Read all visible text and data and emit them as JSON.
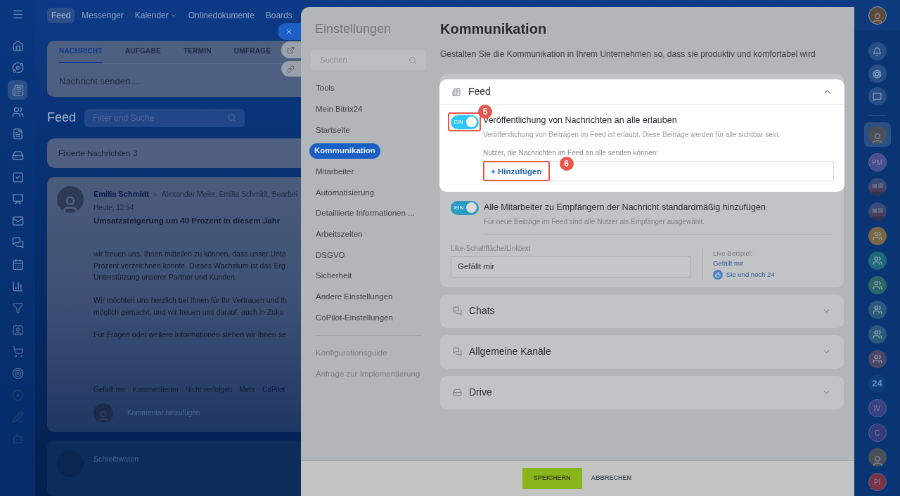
{
  "top_nav": [
    {
      "label": "Feed",
      "selected": true,
      "dropdown": false
    },
    {
      "label": "Messenger",
      "selected": false,
      "dropdown": false
    },
    {
      "label": "Kalender",
      "selected": false,
      "dropdown": true
    },
    {
      "label": "Onlinedokumente",
      "selected": false,
      "dropdown": false
    },
    {
      "label": "Boards",
      "selected": false,
      "dropdown": false
    }
  ],
  "composer": {
    "tabs": [
      {
        "label": "NACHRICHT",
        "selected": true
      },
      {
        "label": "AUFGABE",
        "selected": false
      },
      {
        "label": "TERMIN",
        "selected": false
      },
      {
        "label": "UMFRAGE",
        "selected": false
      }
    ],
    "placeholder": "Nachricht senden ..."
  },
  "feed": {
    "title": "Feed",
    "filter_placeholder": "Filter und Suche",
    "pinned": "Fixierte Nachrichten",
    "pinned_count": "3"
  },
  "post": {
    "author": "Emilia Schmidt",
    "recipients": "Alexander Meier, Emilia Schmidt, Bearbei",
    "time": "Heute, 12:54",
    "title": "Umsatzsteigerung um 40 Prozent in diesem Jahr",
    "paragraphs": [
      [
        "wir freuen uns, Ihnen mitteilen zu können, dass unser Unte",
        "Prozent verzeichnen konnte. Dieses Wachstum ist das Erg",
        "Unterstützung unserer Partner und Kunden."
      ],
      [
        "Wir möchten uns herzlich bei Ihnen für Ihr Vertrauen und Ih",
        "möglich gemacht, und wir freuen uns darauf, auch in Zuku"
      ],
      [
        "Für Fragen oder weitere Informationen stehen wir Ihnen se"
      ]
    ],
    "actions": [
      "Gefällt mir",
      "Kommentieren",
      "Nicht verfolgen",
      "Mehr",
      "CoPilot"
    ],
    "comment_placeholder": "Kommentar hinzufügen"
  },
  "next_post": {
    "author": "Schreibwaren"
  },
  "settings": {
    "title": "Einstellungen",
    "search_placeholder": "Suchen",
    "nav": [
      {
        "label": "Tools",
        "selected": false
      },
      {
        "label": "Mein Bitrix24",
        "selected": false
      },
      {
        "label": "Startseite",
        "selected": false
      },
      {
        "label": "Kommunikation",
        "selected": true
      },
      {
        "label": "Mitarbeiter",
        "selected": false
      },
      {
        "label": "Automatisierung",
        "selected": false
      },
      {
        "label": "Detaillierte Informationen ...",
        "selected": false
      },
      {
        "label": "Arbeitszeiten",
        "selected": false
      },
      {
        "label": "DSGVO",
        "selected": false
      },
      {
        "label": "Sicherheit",
        "selected": false
      },
      {
        "label": "Andere Einstellungen",
        "selected": false
      },
      {
        "label": "CoPilot-Einstellungen",
        "selected": false
      }
    ],
    "nav_links": [
      "Konfigurationsguide",
      "Anfrage zur Implementierung"
    ],
    "page": {
      "title": "Kommunikation",
      "subtitle": "Gestalten Sie die Kommunikation in Ihrem Unternehmen so, dass sie produktiv und komfortabel wird",
      "feed_section": {
        "title": "Feed",
        "expanded": true,
        "publish_toggle": {
          "label": "EIN",
          "on": true,
          "title": "Veröffentlichung von Nachrichten an alle erlauben",
          "description": "Veröffentlichung von Beiträgen im Feed ist erlaubt. Diese Beiträge werden für alle sichtbar sein.",
          "step": "5"
        },
        "users_label": "Nutzer, die Nachrichten im Feed an alle senden können:",
        "add_button": "+ Hinzufügen",
        "add_step": "6",
        "recipients_toggle": {
          "label": "EIN",
          "on": true,
          "title": "Alle Mitarbeiter zu Empfängern der Nachricht standardmäßig hinzufügen",
          "description": "Für neue Beiträge im Feed sind alle Nutzer als Empfänger ausgewählt."
        },
        "like_label": "Like-Schaltfläche/Linktext",
        "like_value": "Gefällt mir",
        "example_label": "Like-Beispiel:",
        "example_link": "Gefällt mir",
        "example_count": "Sie und noch 24"
      },
      "sections": [
        {
          "kind": "chats",
          "title": "Chats",
          "expanded": false
        },
        {
          "kind": "chats",
          "title": "Allgemeine Kanäle",
          "expanded": false
        },
        {
          "kind": "drive",
          "title": "Drive",
          "expanded": false
        }
      ]
    },
    "buttons": {
      "save": "SPEICHERN",
      "cancel": "ABBRECHEN"
    }
  },
  "right_rail": [
    {
      "kind": "avatar",
      "selected": true
    },
    {
      "kind": "initials",
      "text": "PM",
      "color": "#4a4d8c",
      "selected": false
    },
    {
      "kind": "picture",
      "selected": false
    },
    {
      "kind": "picture",
      "selected": false
    },
    {
      "kind": "group",
      "color": "#7c6542",
      "selected": false
    },
    {
      "kind": "group",
      "color": "#1e6a78",
      "selected": false
    },
    {
      "kind": "group",
      "color": "#2a6668",
      "selected": false
    },
    {
      "kind": "group",
      "color": "#2a5a7c",
      "selected": false
    },
    {
      "kind": "group",
      "color": "#2a5a7c",
      "selected": false
    },
    {
      "kind": "group",
      "color": "#4a4866",
      "selected": false
    },
    {
      "kind": "number",
      "text": "24",
      "color": "#0b3f80",
      "selected": false
    },
    {
      "kind": "initials",
      "text": "IV",
      "color": "#3a3f80",
      "selected": false
    },
    {
      "kind": "initials",
      "text": "C",
      "color": "#363b7a",
      "selected": false
    },
    {
      "kind": "avatar",
      "selected": false
    },
    {
      "kind": "initials",
      "text": "PI",
      "color": "#7a3340",
      "selected": false
    }
  ]
}
